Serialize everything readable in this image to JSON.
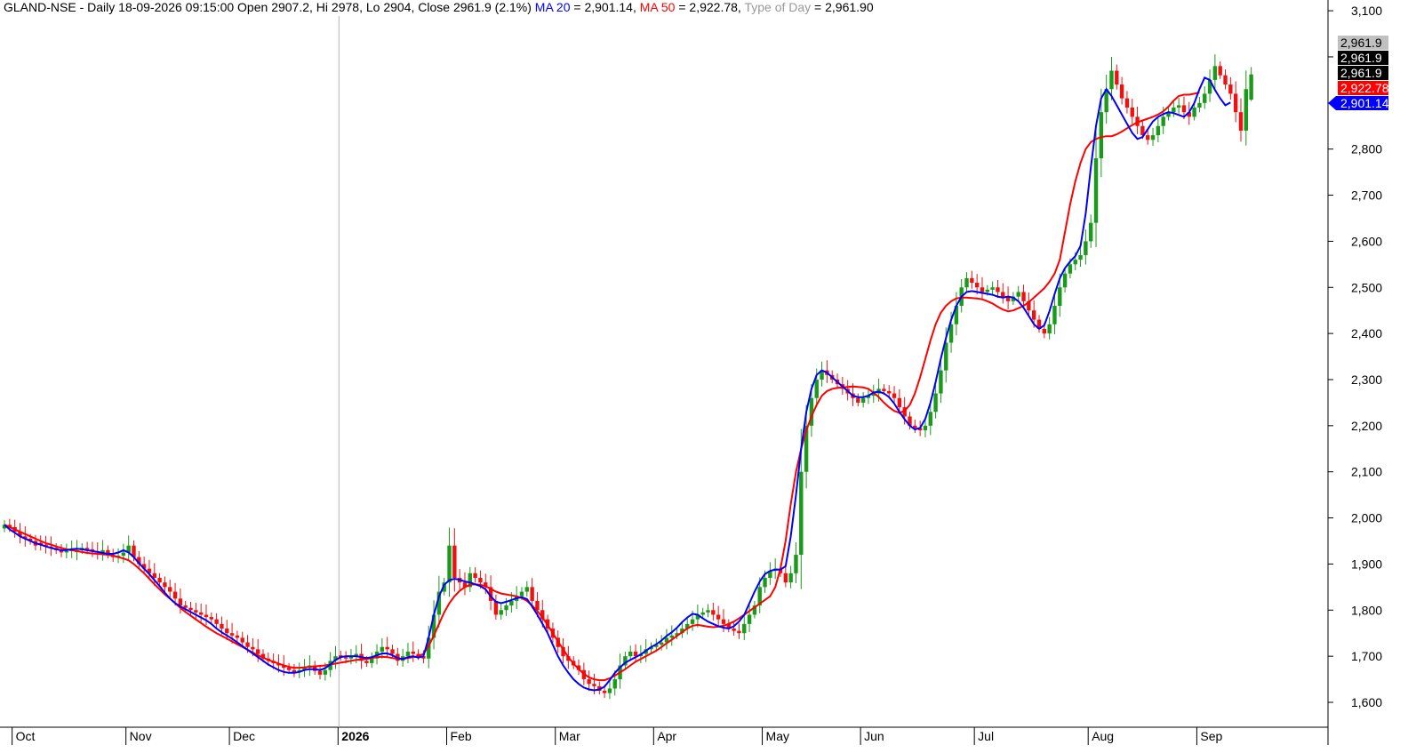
{
  "header": {
    "symbol": "GLAND-NSE",
    "sep1": " - ",
    "interval": "Daily",
    "datetime": "18-09-2026 09:15:00",
    "open_label": "Open",
    "open": "2907.2",
    "hi_label": "Hi",
    "hi": "2978",
    "lo_label": "Lo",
    "lo": "2904",
    "close_label": "Close",
    "close": "2961.9",
    "change": "(2.1%)",
    "ma20_label": "MA 20",
    "ma20_value": "2,901.14",
    "ma50_label": "MA 50",
    "ma50_value": "2,922.78",
    "tod_label": "Type of Day",
    "tod_value": "2,961.90"
  },
  "colors": {
    "up": "#1a9a1a",
    "down": "#ee1111",
    "ma20": "#0000ff",
    "ma50": "#ff0000",
    "tod": "#999999",
    "tag_black": "#000000",
    "tag_grey": "#c0c0c0"
  },
  "price_tags": [
    {
      "label": "2,961.9",
      "value": 2961.9,
      "bg": "#c0c0c0",
      "fg": "#000000",
      "row": 0
    },
    {
      "label": "2,961.9",
      "value": 2961.9,
      "bg": "#000000",
      "fg": "#ffffff",
      "row": 1
    },
    {
      "label": "2,961.9",
      "value": 2961.9,
      "bg": "#000000",
      "fg": "#ffffff",
      "row": 2
    },
    {
      "label": "2,922.78",
      "value": 2922.78,
      "bg": "#ff0000",
      "fg": "#ffffff",
      "row": 3
    },
    {
      "label": "2,901.14",
      "value": 2901.14,
      "bg": "#0000ff",
      "fg": "#ffffff",
      "row": 4
    }
  ],
  "chart_data": {
    "type": "candlestick",
    "title": "",
    "y_ticks": [
      "1,600",
      "1,700",
      "1,800",
      "1,900",
      "2,000",
      "2,100",
      "2,200",
      "2,300",
      "2,400",
      "2,500",
      "2,600",
      "2,700",
      "2,800",
      "2,900",
      "3,000",
      "3,100"
    ],
    "y_tick_values": [
      1600,
      1700,
      1800,
      1900,
      2000,
      2100,
      2200,
      2300,
      2400,
      2500,
      2600,
      2700,
      2800,
      2900,
      3000,
      3100
    ],
    "ylim": [
      1560,
      3110
    ],
    "months": [
      "Oct",
      "Nov",
      "Dec",
      "2026",
      "Feb",
      "Mar",
      "Apr",
      "May",
      "Jun",
      "Jul",
      "Aug",
      "Sep"
    ],
    "month_start_index": [
      2,
      24,
      44,
      65,
      86,
      107,
      126,
      147,
      166,
      188,
      210,
      231
    ],
    "year_marker_index": 65,
    "closes": [
      1985,
      1980,
      1970,
      1960,
      1955,
      1950,
      1940,
      1942,
      1938,
      1935,
      1930,
      1925,
      1928,
      1932,
      1930,
      1935,
      1932,
      1928,
      1925,
      1930,
      1920,
      1915,
      1918,
      1925,
      1940,
      1915,
      1900,
      1890,
      1880,
      1870,
      1860,
      1850,
      1840,
      1825,
      1810,
      1805,
      1800,
      1795,
      1790,
      1785,
      1780,
      1770,
      1760,
      1750,
      1745,
      1740,
      1730,
      1720,
      1715,
      1705,
      1695,
      1690,
      1685,
      1680,
      1675,
      1670,
      1665,
      1670,
      1675,
      1680,
      1668,
      1660,
      1670,
      1690,
      1700,
      1698,
      1695,
      1700,
      1705,
      1690,
      1685,
      1695,
      1710,
      1720,
      1715,
      1705,
      1690,
      1700,
      1710,
      1705,
      1700,
      1695,
      1740,
      1790,
      1840,
      1860,
      1940,
      1870,
      1860,
      1850,
      1880,
      1870,
      1860,
      1850,
      1820,
      1790,
      1800,
      1810,
      1820,
      1830,
      1840,
      1850,
      1820,
      1800,
      1780,
      1760,
      1740,
      1720,
      1700,
      1690,
      1680,
      1670,
      1650,
      1640,
      1635,
      1625,
      1620,
      1630,
      1650,
      1680,
      1700,
      1710,
      1700,
      1705,
      1715,
      1720,
      1725,
      1730,
      1740,
      1745,
      1750,
      1760,
      1770,
      1780,
      1790,
      1795,
      1800,
      1790,
      1780,
      1770,
      1760,
      1755,
      1750,
      1770,
      1790,
      1810,
      1850,
      1870,
      1885,
      1890,
      1880,
      1860,
      1880,
      1920,
      2100,
      2200,
      2260,
      2300,
      2320,
      2310,
      2300,
      2290,
      2280,
      2270,
      2260,
      2250,
      2260,
      2265,
      2270,
      2280,
      2275,
      2270,
      2260,
      2240,
      2220,
      2200,
      2195,
      2190,
      2200,
      2230,
      2270,
      2320,
      2380,
      2420,
      2460,
      2500,
      2520,
      2510,
      2500,
      2490,
      2495,
      2500,
      2490,
      2480,
      2470,
      2480,
      2490,
      2470,
      2450,
      2430,
      2410,
      2400,
      2420,
      2460,
      2500,
      2530,
      2550,
      2560,
      2570,
      2600,
      2640,
      2780,
      2880,
      2930,
      2970,
      2940,
      2910,
      2890,
      2870,
      2850,
      2830,
      2820,
      2830,
      2850,
      2870,
      2880,
      2890,
      2895,
      2880,
      2870,
      2890,
      2900,
      2920,
      2950,
      2980,
      2960,
      2940,
      2920,
      2880,
      2840,
      2930,
      2961.9
    ],
    "ma20": [
      1985,
      1975,
      1968,
      1960,
      1955,
      1950,
      1945,
      1942,
      1938,
      1935,
      1932,
      1930,
      1930,
      1932,
      1933,
      1932,
      1930,
      1928,
      1926,
      1924,
      1922,
      1922,
      1925,
      1930,
      1925,
      1915,
      1902,
      1890,
      1878,
      1865,
      1852,
      1838,
      1825,
      1815,
      1808,
      1802,
      1796,
      1790,
      1784,
      1778,
      1770,
      1760,
      1752,
      1745,
      1738,
      1730,
      1722,
      1714,
      1706,
      1698,
      1690,
      1682,
      1676,
      1670,
      1666,
      1664,
      1664,
      1666,
      1670,
      1672,
      1672,
      1670,
      1674,
      1682,
      1692,
      1698,
      1700,
      1700,
      1700,
      1698,
      1696,
      1698,
      1702,
      1706,
      1706,
      1702,
      1696,
      1694,
      1698,
      1700,
      1697,
      1700,
      1740,
      1790,
      1830,
      1855,
      1865,
      1868,
      1866,
      1862,
      1860,
      1856,
      1852,
      1845,
      1830,
      1818,
      1815,
      1818,
      1822,
      1826,
      1828,
      1824,
      1808,
      1790,
      1770,
      1750,
      1725,
      1700,
      1680,
      1664,
      1650,
      1640,
      1632,
      1628,
      1626,
      1628,
      1634,
      1648,
      1664,
      1676,
      1686,
      1692,
      1698,
      1704,
      1712,
      1720,
      1726,
      1734,
      1744,
      1752,
      1762,
      1774,
      1784,
      1792,
      1790,
      1782,
      1775,
      1770,
      1765,
      1762,
      1760,
      1765,
      1775,
      1790,
      1815,
      1840,
      1862,
      1878,
      1885,
      1888,
      1888,
      1895,
      1960,
      2050,
      2150,
      2230,
      2280,
      2310,
      2320,
      2315,
      2305,
      2295,
      2285,
      2275,
      2265,
      2262,
      2262,
      2265,
      2272,
      2274,
      2270,
      2262,
      2248,
      2230,
      2214,
      2200,
      2192,
      2195,
      2215,
      2250,
      2295,
      2345,
      2390,
      2430,
      2460,
      2480,
      2490,
      2492,
      2490,
      2488,
      2486,
      2484,
      2480,
      2478,
      2480,
      2478,
      2470,
      2456,
      2438,
      2420,
      2410,
      2418,
      2448,
      2486,
      2520,
      2542,
      2556,
      2568,
      2590,
      2660,
      2760,
      2850,
      2910,
      2930,
      2915,
      2895,
      2875,
      2855,
      2835,
      2822,
      2826,
      2843,
      2860,
      2870,
      2876,
      2880,
      2878,
      2874,
      2870,
      2880,
      2900,
      2930,
      2955,
      2950,
      2928,
      2910,
      2895,
      2901.14
    ],
    "ma50": [
      1985,
      1980,
      1975,
      1970,
      1965,
      1960,
      1955,
      1950,
      1945,
      1942,
      1938,
      1935,
      1932,
      1930,
      1928,
      1926,
      1924,
      1923,
      1922,
      1921,
      1920,
      1918,
      1915,
      1912,
      1908,
      1900,
      1890,
      1880,
      1868,
      1856,
      1845,
      1834,
      1825,
      1815,
      1805,
      1796,
      1788,
      1780,
      1772,
      1764,
      1757,
      1750,
      1744,
      1738,
      1732,
      1726,
      1720,
      1714,
      1708,
      1702,
      1697,
      1692,
      1688,
      1684,
      1680,
      1677,
      1675,
      1675,
      1676,
      1677,
      1678,
      1679,
      1680,
      1682,
      1684,
      1686,
      1688,
      1690,
      1692,
      1693,
      1694,
      1696,
      1698,
      1699,
      1698,
      1696,
      1694,
      1694,
      1696,
      1698,
      1700,
      1705,
      1722,
      1745,
      1770,
      1795,
      1815,
      1830,
      1842,
      1850,
      1855,
      1856,
      1855,
      1852,
      1846,
      1840,
      1836,
      1834,
      1832,
      1830,
      1826,
      1820,
      1810,
      1798,
      1784,
      1768,
      1750,
      1732,
      1715,
      1698,
      1684,
      1672,
      1662,
      1654,
      1650,
      1648,
      1648,
      1652,
      1658,
      1665,
      1672,
      1680,
      1688,
      1694,
      1700,
      1706,
      1712,
      1720,
      1728,
      1736,
      1744,
      1752,
      1760,
      1766,
      1768,
      1766,
      1764,
      1763,
      1764,
      1766,
      1770,
      1775,
      1782,
      1790,
      1798,
      1806,
      1814,
      1822,
      1830,
      1850,
      1890,
      1950,
      2030,
      2100,
      2150,
      2190,
      2220,
      2245,
      2265,
      2275,
      2280,
      2282,
      2283,
      2284,
      2285,
      2284,
      2283,
      2280,
      2272,
      2262,
      2250,
      2240,
      2232,
      2228,
      2232,
      2245,
      2270,
      2305,
      2345,
      2385,
      2420,
      2445,
      2460,
      2470,
      2476,
      2478,
      2478,
      2477,
      2476,
      2474,
      2470,
      2465,
      2458,
      2452,
      2448,
      2450,
      2455,
      2460,
      2468,
      2478,
      2488,
      2498,
      2512,
      2530,
      2560,
      2620,
      2680,
      2730,
      2770,
      2800,
      2815,
      2822,
      2826,
      2828,
      2828,
      2832,
      2838,
      2845,
      2852,
      2858,
      2862,
      2866,
      2870,
      2875,
      2882,
      2892,
      2905,
      2915,
      2918,
      2918,
      2920,
      2922.78
    ]
  }
}
